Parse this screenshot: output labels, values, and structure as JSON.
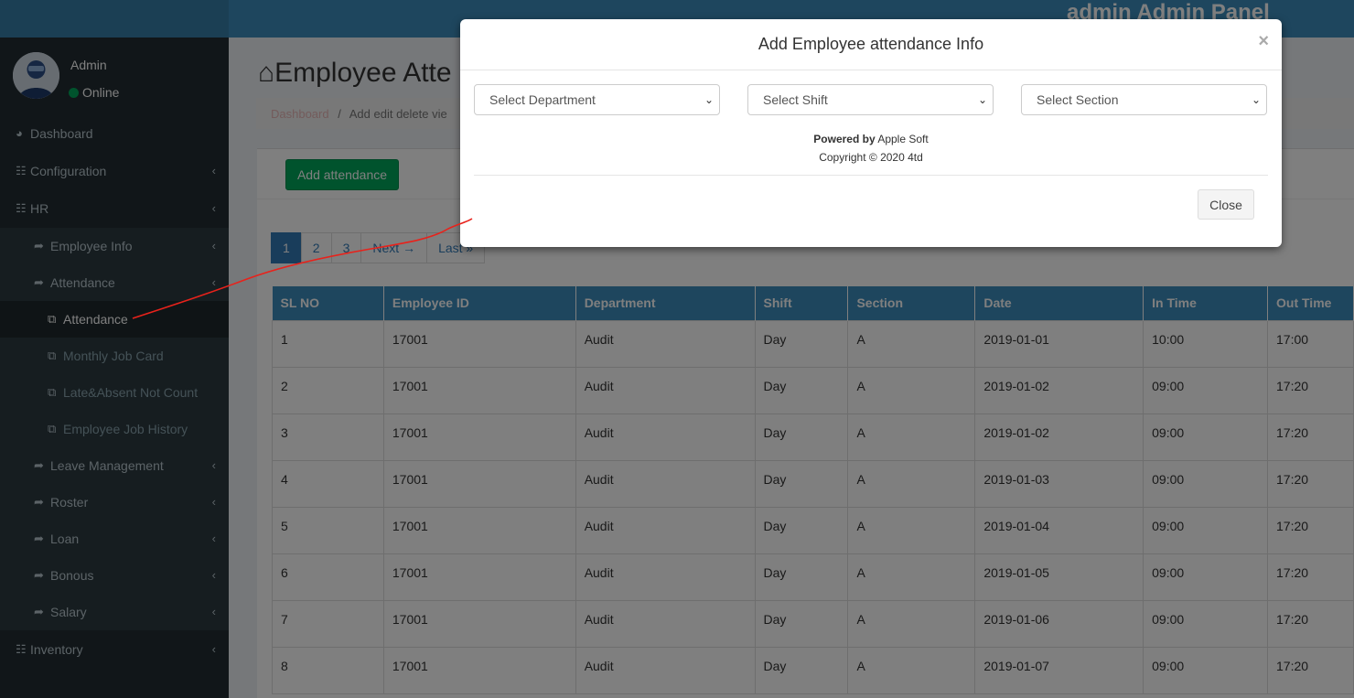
{
  "header": {
    "panel_title": "admin Admin Panel"
  },
  "user": {
    "name": "Admin",
    "status": "Online"
  },
  "sidebar": {
    "dashboard": "Dashboard",
    "configuration": "Configuration",
    "hr": "HR",
    "employee_info": "Employee Info",
    "attendance_group": "Attendance",
    "attendance": "Attendance",
    "monthly_job_card": "Monthly Job Card",
    "late_absent": "Late&Absent Not Count",
    "employee_job_history": "Employee Job History",
    "leave_management": "Leave Management",
    "roster": "Roster",
    "loan": "Loan",
    "bonous": "Bonous",
    "salary": "Salary",
    "inventory": "Inventory"
  },
  "page": {
    "title": "Employee Atte",
    "breadcrumb_home": "Dashboard",
    "breadcrumb_sep": "/",
    "breadcrumb_current": "Add edit delete vie",
    "add_button": "Add attendance",
    "pagination": [
      "1",
      "2",
      "3",
      "Next →",
      "Last »"
    ]
  },
  "table": {
    "headers": [
      "SL NO",
      "Employee ID",
      "Department",
      "Shift",
      "Section",
      "Date",
      "In Time",
      "Out Time"
    ],
    "rows": [
      [
        "1",
        "17001",
        "Audit",
        "Day",
        "A",
        "2019-01-01",
        "10:00",
        "17:00"
      ],
      [
        "2",
        "17001",
        "Audit",
        "Day",
        "A",
        "2019-01-02",
        "09:00",
        "17:20"
      ],
      [
        "3",
        "17001",
        "Audit",
        "Day",
        "A",
        "2019-01-02",
        "09:00",
        "17:20"
      ],
      [
        "4",
        "17001",
        "Audit",
        "Day",
        "A",
        "2019-01-03",
        "09:00",
        "17:20"
      ],
      [
        "5",
        "17001",
        "Audit",
        "Day",
        "A",
        "2019-01-04",
        "09:00",
        "17:20"
      ],
      [
        "6",
        "17001",
        "Audit",
        "Day",
        "A",
        "2019-01-05",
        "09:00",
        "17:20"
      ],
      [
        "7",
        "17001",
        "Audit",
        "Day",
        "A",
        "2019-01-06",
        "09:00",
        "17:20"
      ],
      [
        "8",
        "17001",
        "Audit",
        "Day",
        "A",
        "2019-01-07",
        "09:00",
        "17:20"
      ]
    ]
  },
  "modal": {
    "title": "Add Employee attendance Info",
    "close_x": "×",
    "select_department": "Select Department",
    "select_shift": "Select Shift",
    "select_section": "Select Section",
    "powered_by_label": "Powered by",
    "powered_by_value": "Apple Soft",
    "copyright": "Copyright © 2020 4td",
    "close_button": "Close"
  },
  "colors": {
    "header": "#3c8dbc",
    "sidebar": "#222d32",
    "success": "#00a65a",
    "annotation": "#e8221b"
  },
  "icons": [
    "dashboard-icon",
    "sitemap-icon",
    "share-icon",
    "copy-icon",
    "chevron-left-icon",
    "home-icon"
  ]
}
